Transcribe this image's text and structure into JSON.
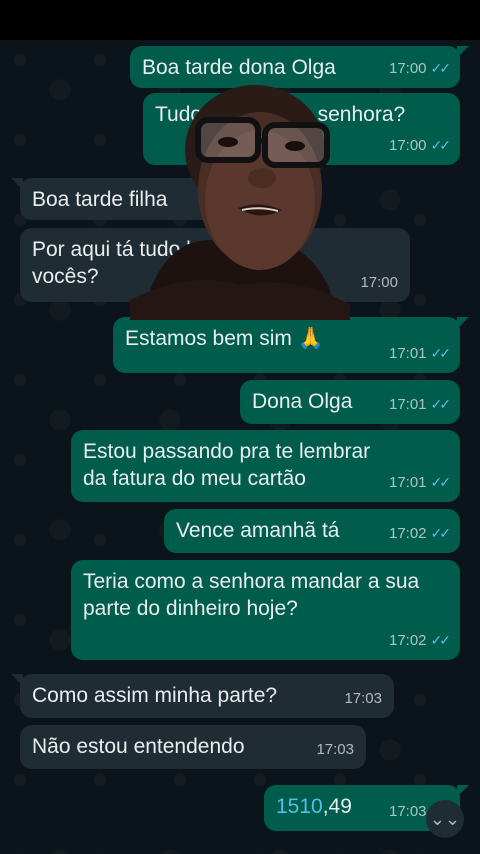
{
  "messages": [
    {
      "id": "m1",
      "dir": "out",
      "text": "Boa tarde dona Olga",
      "time": "17:00",
      "ticks": "✓✓"
    },
    {
      "id": "m2",
      "dir": "out",
      "text": "Tudo bem com a senhora?",
      "time": "17:00",
      "ticks": "✓✓"
    },
    {
      "id": "m3",
      "dir": "in",
      "text": "Boa tarde filha",
      "time": ""
    },
    {
      "id": "m4",
      "dir": "in",
      "text": "Por aqui tá tudo bem e com vocês?",
      "time": "17:00"
    },
    {
      "id": "m5",
      "dir": "out",
      "text": "Estamos bem sim 🙏",
      "time": "17:01",
      "ticks": "✓✓"
    },
    {
      "id": "m6",
      "dir": "out",
      "text": "Dona Olga",
      "time": "17:01",
      "ticks": "✓✓"
    },
    {
      "id": "m7",
      "dir": "out",
      "text": "Estou passando pra te lembrar da fatura do meu cartão",
      "time": "17:01",
      "ticks": "✓✓"
    },
    {
      "id": "m8",
      "dir": "out",
      "text": "Vence amanhã tá",
      "time": "17:02",
      "ticks": "✓✓"
    },
    {
      "id": "m9",
      "dir": "out",
      "text": "Teria como a senhora mandar a sua parte do dinheiro hoje?",
      "time": "17:02",
      "ticks": "✓✓"
    },
    {
      "id": "m10",
      "dir": "in",
      "text": "Como assim minha parte?",
      "time": "17:03"
    },
    {
      "id": "m11",
      "dir": "in",
      "text": "Não estou entendendo",
      "time": "17:03"
    },
    {
      "id": "m12",
      "dir": "out",
      "text_link": "1510",
      "text_rest": ",49",
      "time": "17:03",
      "ticks": "✓✓"
    }
  ],
  "scroll_button": {
    "icon": "double-chevron-down-icon",
    "glyph": "⌄⌄"
  },
  "colors": {
    "outgoing": "#005c4b",
    "incoming": "#202c33",
    "background": "#0b141a",
    "ticks": "#53bdeb"
  }
}
